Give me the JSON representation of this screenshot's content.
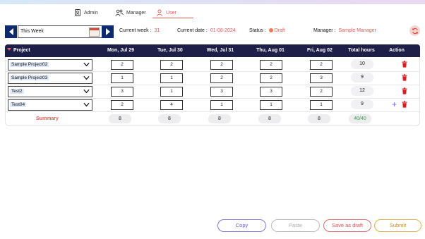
{
  "nav": {
    "items": [
      {
        "label": "Admin",
        "icon": "id-card-icon",
        "active": false
      },
      {
        "label": "Manager",
        "icon": "people-icon",
        "active": false
      },
      {
        "label": "User",
        "icon": "user-icon",
        "active": true
      }
    ]
  },
  "week": {
    "value": "This Week",
    "prev_icon": "arrow-left-icon",
    "next_icon": "arrow-right-icon",
    "calendar_icon": "calendar-icon"
  },
  "info": {
    "current_week_label": "Current week :",
    "current_week_value": "31",
    "current_date_label": "Current date :",
    "current_date_value": "01-08-2024",
    "status_label": "Status :",
    "status_value": "Draft",
    "manager_label": "Manager :",
    "manager_value": "Sample Manager"
  },
  "table": {
    "columns": {
      "project": "Project",
      "d1": "Mon, Jul 29",
      "d2": "Tue, Jul 30",
      "d3": "Wed, Jul 31",
      "d4": "Thu, Aug 01",
      "d5": "Fri, Aug 02",
      "total": "Total hours",
      "action": "Action"
    },
    "rows": [
      {
        "project": "Sample Project02",
        "h": [
          "2",
          "2",
          "2",
          "2",
          "2"
        ],
        "total": "10"
      },
      {
        "project": "Sample Project03",
        "h": [
          "1",
          "1",
          "2",
          "2",
          "3"
        ],
        "total": "9"
      },
      {
        "project": "Test2",
        "h": [
          "3",
          "1",
          "3",
          "3",
          "2"
        ],
        "total": "12"
      },
      {
        "project": "Test04",
        "h": [
          "2",
          "4",
          "1",
          "1",
          "1"
        ],
        "total": "9"
      }
    ],
    "summary": {
      "label": "Summary",
      "values": [
        "8",
        "8",
        "8",
        "8",
        "8"
      ],
      "total": "40/40"
    }
  },
  "buttons": {
    "copy": "Copy",
    "paste": "Paste",
    "save_draft": "Save as draft",
    "submit": "Submit"
  },
  "colors": {
    "accent": "#e05a5a",
    "header_bg": "#1d1f48",
    "nav_blue": "#0e2a6e"
  }
}
